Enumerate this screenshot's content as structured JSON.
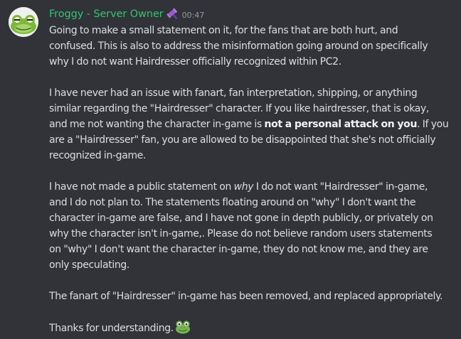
{
  "message": {
    "author": "Froggy - Server Owner",
    "role_icon": "gavel-icon",
    "timestamp": "00:47",
    "colors": {
      "background": "#313338",
      "username": "#2dc770",
      "text": "#dbdee1",
      "timestamp": "#949ba4",
      "role_icon": "#9b59d0"
    },
    "paragraphs": {
      "p1": {
        "l1": "Going to make a small statement on it, for the fans that are both hurt, and",
        "l2": "confused. This is also to address the misinformation going around on specifically",
        "l3": "why I do not want Hairdresser officially recognized within PC2."
      },
      "p2": {
        "l1": "I have never had an issue with fanart, fan interpretation, shipping, or anything",
        "l2": "similar regarding the \"Hairdresser\" character. If you like hairdresser, that is okay,",
        "l3a": "and me not wanting the character in-game is ",
        "l3b": "not a personal attack on you",
        "l3c": ". If you",
        "l4": "are a \"Hairdresser\" fan, you are allowed to be disappointed that she's not officially",
        "l5": "recognized in-game."
      },
      "p3": {
        "l1a": "I have not made a public statement on ",
        "l1b": "why",
        "l1c": " I do not want \"Hairdresser\" in-game,",
        "l2": "and I do not plan to. The statements floating around on \"why\" I don't want the",
        "l3": "character in-game are false, and I have not gone in depth publicly, or privately on",
        "l4": "why the character isn't in-game,. Please do not believe random users statements",
        "l5": "on \"why\" I don't want the character in-game, they do not know me, and they are",
        "l6": "only speculating."
      },
      "p4": {
        "l1": "The fanart of \"Hairdresser\" in-game has been removed, and replaced appropriately."
      },
      "p5": {
        "l1": "Thanks for understanding.",
        "emoji": "frog-face-icon"
      }
    }
  }
}
